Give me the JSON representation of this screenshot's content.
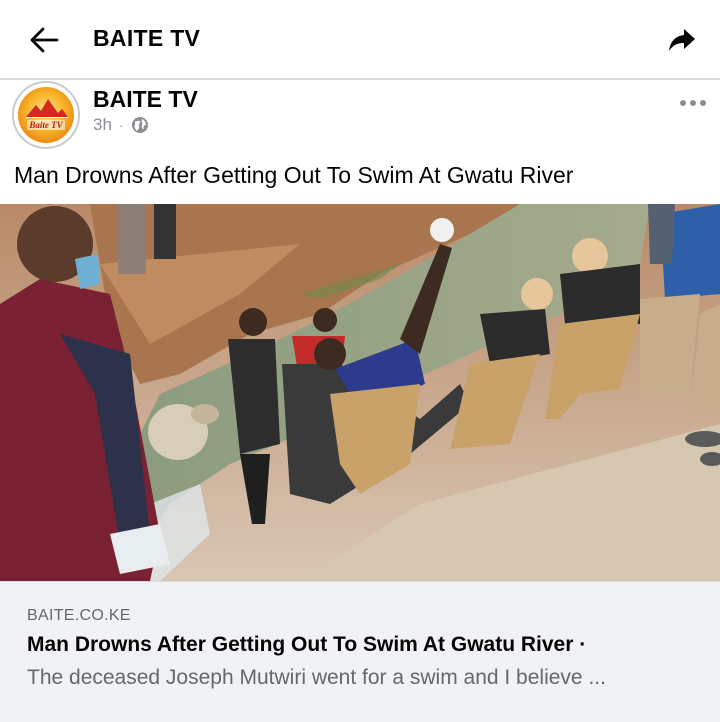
{
  "topbar": {
    "title": "BAITE TV",
    "back_icon": "arrow-left-icon",
    "share_icon": "share-arrow-icon"
  },
  "post": {
    "page_name": "BAITE TV",
    "avatar_logo_text": "Baite TV",
    "time_ago": "3h",
    "separator": "·",
    "audience_icon": "globe-icon",
    "more_icon": "more-horizontal-icon",
    "caption": "Man Drowns After Getting Out To Swim At Gwatu River"
  },
  "link_preview": {
    "domain": "BAITE.CO.KE",
    "title": "Man Drowns After Getting Out To Swim At Gwatu River ·",
    "description": "The deceased Joseph Mutwiri went for a swim and I believe ..."
  },
  "colors": {
    "text_primary": "#050505",
    "text_secondary": "#65676b",
    "meta_grey": "#8a8d91",
    "preview_bg": "#f0f2f5",
    "logo_orange": "#f4a11a",
    "logo_red": "#d6281f"
  }
}
